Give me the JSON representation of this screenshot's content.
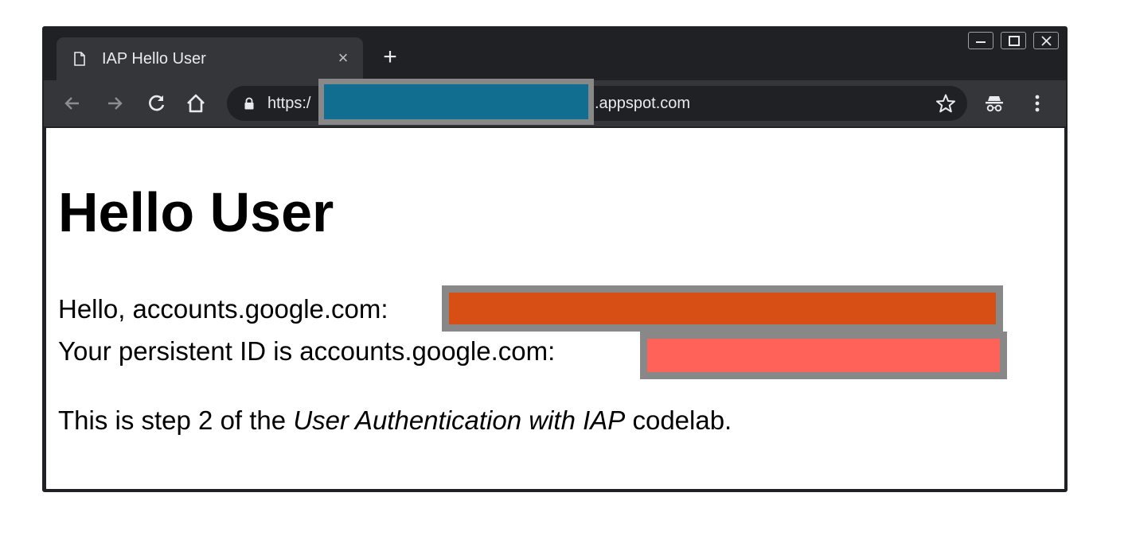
{
  "browser": {
    "tab": {
      "title": "IAP Hello User",
      "close_glyph": "×",
      "icon": "document-icon"
    },
    "new_tab_glyph": "+",
    "window_controls": [
      "minimize-icon",
      "maximize-icon",
      "close-icon"
    ],
    "toolbar": {
      "buttons": [
        "back-arrow-icon",
        "forward-arrow-icon",
        "reload-icon",
        "home-icon"
      ],
      "address": {
        "prefix": "https:/",
        "suffix": ".appspot.com",
        "lock_icon": "lock-icon"
      },
      "right_icons": [
        "star-icon",
        "incognito-icon",
        "kebab-menu-icon"
      ]
    },
    "colors": {
      "frame": "#202124",
      "toolbar": "#35363a",
      "omnibox": "#202124",
      "text": "#e8eaed"
    }
  },
  "redactions": {
    "url": {
      "outline": "#888888",
      "fill": "#126e91"
    },
    "email": {
      "outline": "#888888",
      "fill": "#d84f16"
    },
    "persistent_id": {
      "outline": "#888888",
      "fill": "#ff6258"
    }
  },
  "page": {
    "heading": "Hello User",
    "greeting_prefix": "Hello, accounts.google.com:",
    "persistent_id_prefix": "Your persistent ID is accounts.google.com:",
    "step_before": "This is step 2 of the ",
    "step_emphasis": "User Authentication with IAP",
    "step_after": " codelab."
  }
}
